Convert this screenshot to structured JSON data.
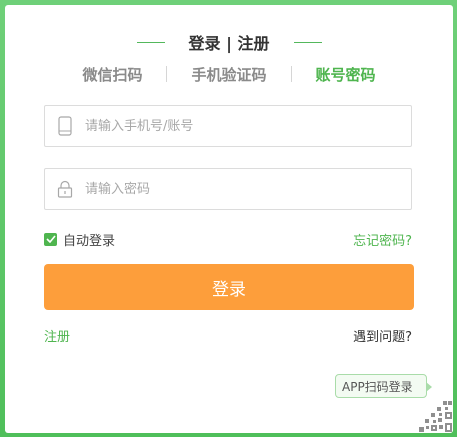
{
  "header": {
    "title": "登录 | 注册"
  },
  "tabs": [
    {
      "label": "微信扫码",
      "active": false
    },
    {
      "label": "手机验证码",
      "active": false
    },
    {
      "label": "账号密码",
      "active": true
    }
  ],
  "form": {
    "phone": {
      "placeholder": "请输入手机号/账号",
      "value": "",
      "icon": "phone-icon"
    },
    "password": {
      "placeholder": "请输入密码",
      "value": "",
      "icon": "lock-icon"
    },
    "remember_label": "自动登录",
    "remember_checked": true,
    "forgot_label": "忘记密码?",
    "submit_label": "登录"
  },
  "footer": {
    "register_label": "注册",
    "problem_label": "遇到问题?"
  },
  "qr": {
    "tooltip": "APP扫码登录",
    "icon": "qr-code-icon"
  },
  "colors": {
    "accent_green": "#4fb54f",
    "button_orange": "#fd9e3b",
    "frame_green": "#5cc565"
  }
}
